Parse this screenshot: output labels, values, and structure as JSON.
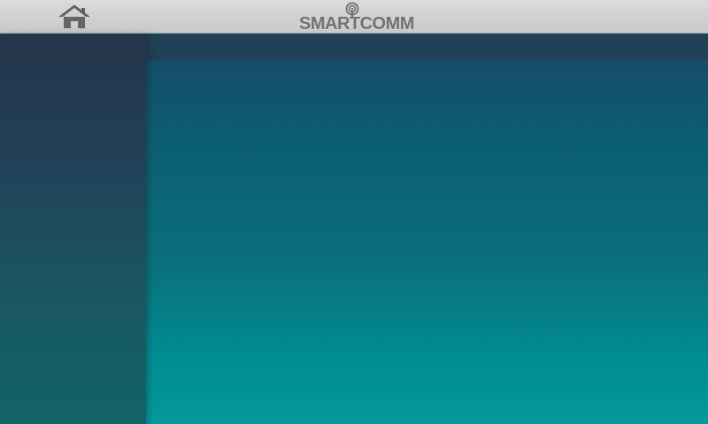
{
  "app": {
    "brand_name": "SMARTCOMM"
  },
  "icons": {
    "home": "home-icon",
    "brand": "broadcast-icon"
  },
  "colors": {
    "topbar": "#d7d7d7",
    "sidebar_top": "#25354a",
    "sidebar_bottom": "#116468",
    "main_top": "#154e68",
    "main_bottom": "#03999b"
  }
}
